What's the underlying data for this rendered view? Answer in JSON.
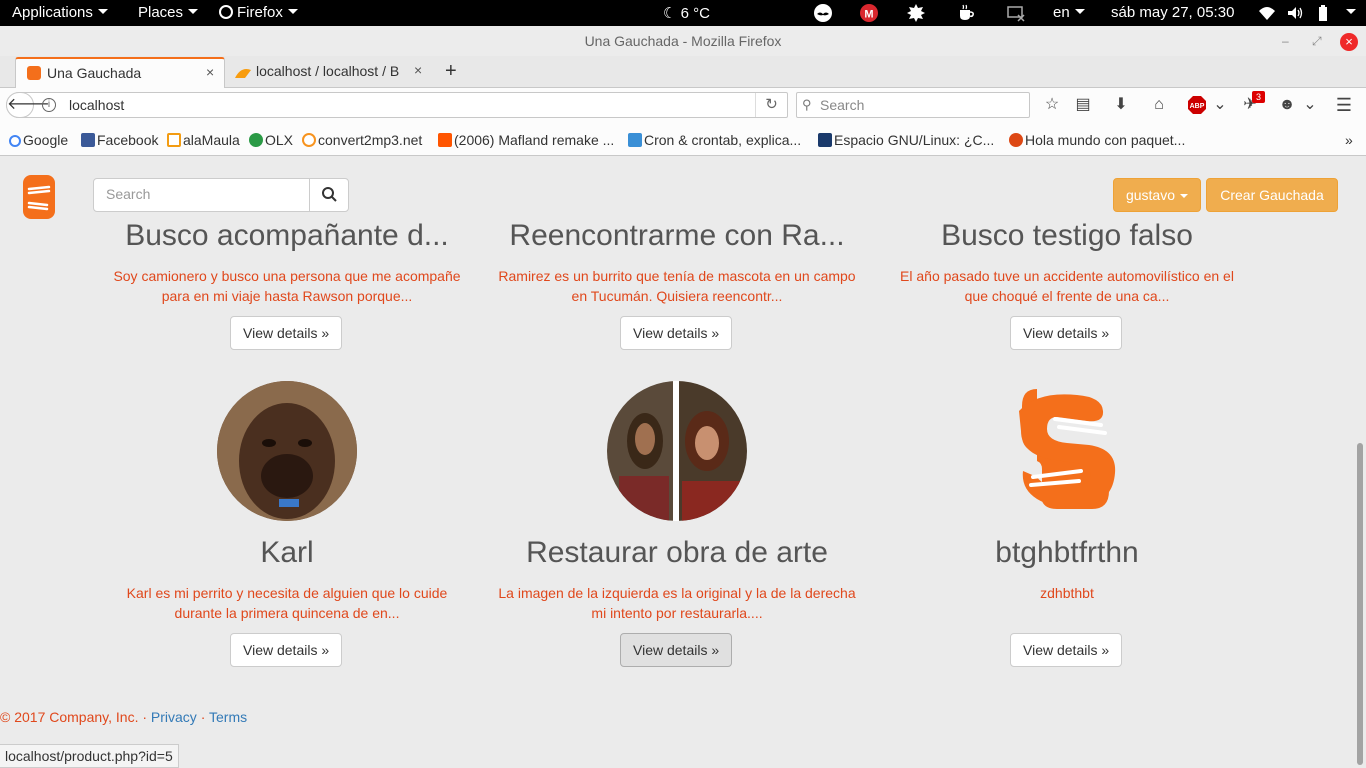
{
  "topbar": {
    "applications": "Applications",
    "places": "Places",
    "firefox": "Firefox",
    "weather": "6 °C",
    "lang": "en",
    "datetime": "sáb may 27, 05:30"
  },
  "window": {
    "title": "Una Gauchada - Mozilla Firefox"
  },
  "tabs": [
    {
      "label": "Una Gauchada"
    },
    {
      "label": "localhost / localhost / B"
    }
  ],
  "nav": {
    "url": "localhost",
    "search_placeholder": "Search",
    "abp_badge": "3"
  },
  "bookmarks": [
    {
      "label": "Google"
    },
    {
      "label": "Facebook"
    },
    {
      "label": "alaMaula"
    },
    {
      "label": "OLX"
    },
    {
      "label": "convert2mp3.net"
    },
    {
      "label": "(2006) Mafland remake ..."
    },
    {
      "label": "Cron & crontab, explica..."
    },
    {
      "label": "Espacio GNU/Linux: ¿C..."
    },
    {
      "label": "Hola mundo con paquet..."
    }
  ],
  "site": {
    "search_placeholder": "Search",
    "user_menu": "gustavo",
    "create_button": "Crear Gauchada"
  },
  "cards": [
    {
      "title": "Busco acompañante d...",
      "desc": "Soy camionero y busco una persona que me acompañe para en mi viaje hasta Rawson porque...",
      "button": "View details »"
    },
    {
      "title": "Reencontrarme con Ra...",
      "desc": "Ramirez es un burrito que tenía de mascota en un campo en Tucumán. Quisiera reencontr...",
      "button": "View details »"
    },
    {
      "title": "Busco testigo falso",
      "desc": "El año pasado tuve un accidente automovilístico en el que choqué el frente de una ca...",
      "button": "View details »"
    },
    {
      "title": "Karl",
      "desc": "Karl es mi perrito y necesita de alguien que lo cuide durante la primera quincena de en...",
      "button": "View details »"
    },
    {
      "title": "Restaurar obra de arte",
      "desc": "La imagen de la izquierda es la original y la de la derecha mi intento por restaurarla....",
      "button": "View details »"
    },
    {
      "title": "btghbtfrthn",
      "desc": "zdhbthbt",
      "button": "View details »"
    }
  ],
  "footer": {
    "copyright": "© 2017 Company, Inc. · ",
    "privacy": "Privacy",
    "sep": " · ",
    "terms": "Terms"
  },
  "status": {
    "url": "localhost/product.php?id=5"
  },
  "colors": {
    "brand": "#f46f1b",
    "desc_text": "#e0481c",
    "button_warning": "#f0ad4e"
  }
}
